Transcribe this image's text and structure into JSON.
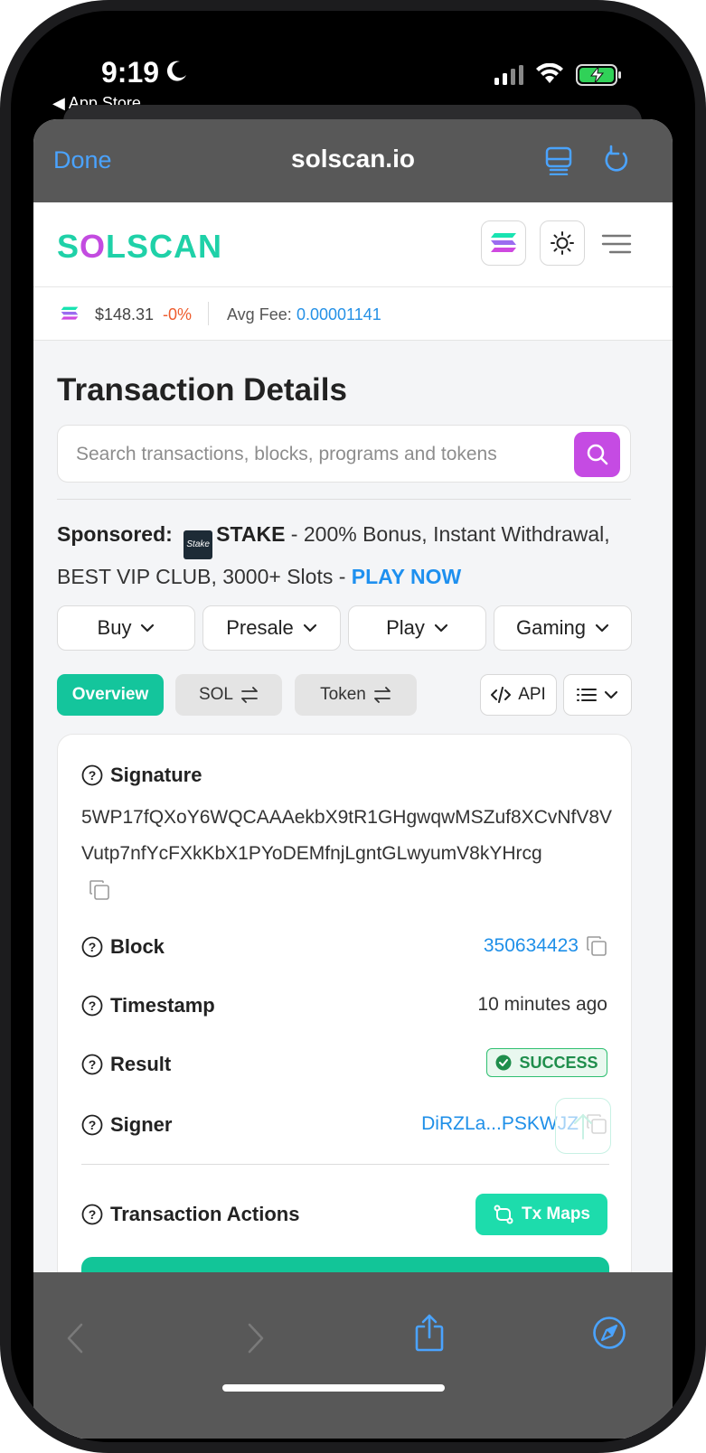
{
  "status_bar": {
    "time": "9:19",
    "back_label": "App Store"
  },
  "browser": {
    "done_label": "Done",
    "domain": "solscan.io"
  },
  "site": {
    "logo_prefix": "S",
    "logo_o": "O",
    "logo_suffix": "LSCAN",
    "sol_price": "$148.31",
    "sol_change": "-0%",
    "avg_fee_label": "Avg Fee:",
    "avg_fee_value": "0.00001141"
  },
  "page": {
    "title": "Transaction Details",
    "search_placeholder": "Search transactions, blocks, programs and tokens"
  },
  "sponsor": {
    "label": "Sponsored:",
    "logo_text": "Stake",
    "brand": "STAKE",
    "text": " - 200% Bonus, Instant Withdrawal, BEST VIP CLUB, 3000+ Slots - ",
    "cta": "PLAY NOW"
  },
  "menus": [
    {
      "label": "Buy"
    },
    {
      "label": "Presale"
    },
    {
      "label": "Play"
    },
    {
      "label": "Gaming"
    }
  ],
  "tabs": {
    "overview": "Overview",
    "sol": "SOL",
    "token": "Token",
    "api": "API"
  },
  "details": {
    "signature_label": "Signature",
    "signature_value": "5WP17fQXoY6WQCAAAekbX9tR1GHgwqwMSZuf8XCvNfV8VVutp7nfYcFXkKbX1PYoDEMfnjLgntGLwyumV8kYHrcg",
    "block_label": "Block",
    "block_value": "350634423",
    "timestamp_label": "Timestamp",
    "timestamp_value": "10 minutes ago",
    "result_label": "Result",
    "result_value": "SUCCESS",
    "signer_label": "Signer",
    "signer_value": "DiRZLa...PSKWJZ",
    "actions_label": "Transaction Actions",
    "txmaps_label": "Tx Maps"
  },
  "colors": {
    "accent_green": "#14c59c",
    "accent_purple": "#c54be3",
    "link_blue": "#1e8fe8",
    "ios_blue": "#4aa3ff"
  }
}
